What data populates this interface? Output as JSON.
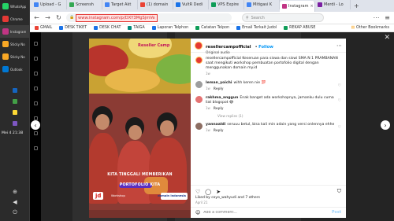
{
  "os": {
    "apps": [
      {
        "label": "WhatsApp",
        "color": "#25d366"
      },
      {
        "label": "Chrome",
        "color": "#e53935"
      },
      {
        "label": "Instagram",
        "color": "#c13584"
      },
      {
        "label": "Sticky No",
        "color": "#f9a825"
      },
      {
        "label": "Sticky No",
        "color": "#f9a825"
      },
      {
        "label": "Outlook",
        "color": "#0078d4"
      }
    ],
    "clock": "Mei 4 21:38"
  },
  "browser": {
    "tabs": [
      {
        "label": "Upload - G",
        "color": "#4285f4"
      },
      {
        "label": "Screensh",
        "color": "#34a853"
      },
      {
        "label": "Target Akt",
        "color": "#4285f4"
      },
      {
        "label": "(1) domain",
        "color": "#ea4335"
      },
      {
        "label": "VultR Dedi",
        "color": "#1a73e8"
      },
      {
        "label": "VPS Expire",
        "color": "#0f9d58"
      },
      {
        "label": "Mitigasi K",
        "color": "#4285f4"
      },
      {
        "label": "Instagram",
        "color": "#c13584",
        "active": true
      },
      {
        "label": "Merdi - Lo",
        "color": "#7b1fa2"
      }
    ],
    "new_tab": "+",
    "url": "www.instagram.com/p/DXY3MgSjmVe",
    "search_placeholder": "Search",
    "bookmarks": [
      {
        "label": "GMAIL",
        "color": "#ea4335"
      },
      {
        "label": "DESK TIKET",
        "color": "#1a73e8"
      },
      {
        "label": "DESK CHAT",
        "color": "#1a73e8"
      },
      {
        "label": "TAIGA",
        "color": "#00897b"
      },
      {
        "label": "Laporan Telphon",
        "color": "#1a73e8"
      },
      {
        "label": "Catatan Telpon",
        "color": "#0f9d58"
      },
      {
        "label": "Email Terkait Judol",
        "color": "#1a73e8"
      },
      {
        "label": "REKAP ABUSE",
        "color": "#0f9d58"
      }
    ],
    "other_bookmarks": "Other Bookmarks"
  },
  "post": {
    "username": "resellercampofficial",
    "follow": "Follow",
    "audio": "Original audio",
    "caption": "resellercampofficial Keseruan para siswa dan siswi SMA N 1 PRAMBANAN saat mengikuti workshop pembuatan portofolio digital dengan menggunakan domain my.id",
    "caption_time": "1w",
    "comments": [
      {
        "user": "leman_yoichi",
        "text": "wihh keren nie 💯",
        "time": "1w",
        "reply": "Reply",
        "avatar": "#9e9e9e"
      },
      {
        "user": "rakhma_anggun",
        "text": "Enak banget ada workshopnya, jamanku dulu cuma liat blogspot 😂",
        "time": "1w",
        "reply": "Reply",
        "avatar": "#e57373"
      },
      {
        "user": "yannaaldi",
        "text": "seruuu betul, bisa kali min adain yang versi onlennya ehhe",
        "time": "1w",
        "reply": "Reply",
        "avatar": "#8d6e63"
      }
    ],
    "view_replies": "View replies (1)",
    "liked_by": "Liked by coyo_wahyudi and 7 others",
    "date": "April 21",
    "add_comment_placeholder": "Add a comment...",
    "post_button": "Post"
  },
  "media": {
    "top_brand": "Reseller Camp",
    "caption_line1": "KITA TINGGALI MEMBERIKAN",
    "caption_line2": "PORTOFOLIO KITA",
    "logo_jd": "jd",
    "logo_text": "Workshop",
    "domain_logo": "domain indonesia"
  }
}
